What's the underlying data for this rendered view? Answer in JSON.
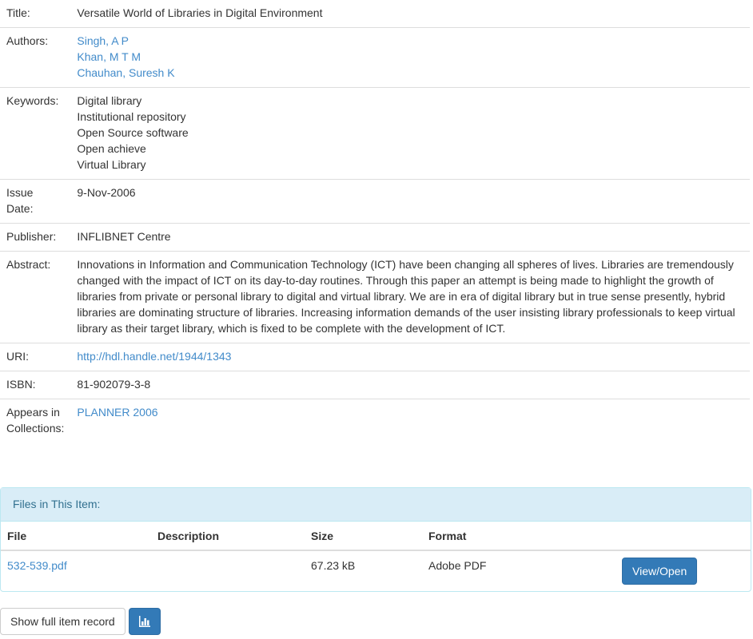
{
  "item": {
    "title_label": "Title:",
    "title": "Versatile World of Libraries in Digital Environment",
    "authors_label": "Authors:",
    "authors": [
      "Singh, A P",
      "Khan, M T M",
      "Chauhan, Suresh K"
    ],
    "keywords_label": "Keywords:",
    "keywords": [
      "Digital library",
      "Institutional repository",
      "Open Source software",
      "Open achieve",
      "Virtual Library"
    ],
    "issue_date_label_1": "Issue",
    "issue_date_label_2": "Date:",
    "issue_date": "9-Nov-2006",
    "publisher_label": "Publisher:",
    "publisher": "INFLIBNET Centre",
    "abstract_label": "Abstract:",
    "abstract": "Innovations in Information and Communication Technology (ICT) have been changing all spheres of lives. Libraries are tremendously changed with the impact of ICT on its day-to-day routines. Through this paper an attempt is being made to highlight the growth of libraries from private or personal library to digital and virtual library. We are in era of digital library but in true sense presently, hybrid libraries are dominating structure of libraries. Increasing information demands of the user insisting library professionals to keep virtual library as their target library, which is fixed to be complete with the development of ICT.",
    "uri_label": "URI:",
    "uri": "http://hdl.handle.net/1944/1343",
    "isbn_label": "ISBN:",
    "isbn": "81-902079-3-8",
    "collections_label_1": "Appears in",
    "collections_label_2": "Collections:",
    "collection": "PLANNER 2006"
  },
  "files": {
    "heading": "Files in This Item:",
    "columns": [
      "File",
      "Description",
      "Size",
      "Format"
    ],
    "rows": [
      {
        "file": "532-539.pdf",
        "description": "",
        "size": "67.23 kB",
        "format": "Adobe PDF",
        "action": "View/Open"
      }
    ]
  },
  "buttons": {
    "full_record": "Show full item record",
    "stats_icon": "bar-chart-icon"
  },
  "colors": {
    "link": "#428bca",
    "primary": "#337ab7",
    "panel_heading_bg": "#d9edf7",
    "panel_heading_text": "#31708f"
  }
}
